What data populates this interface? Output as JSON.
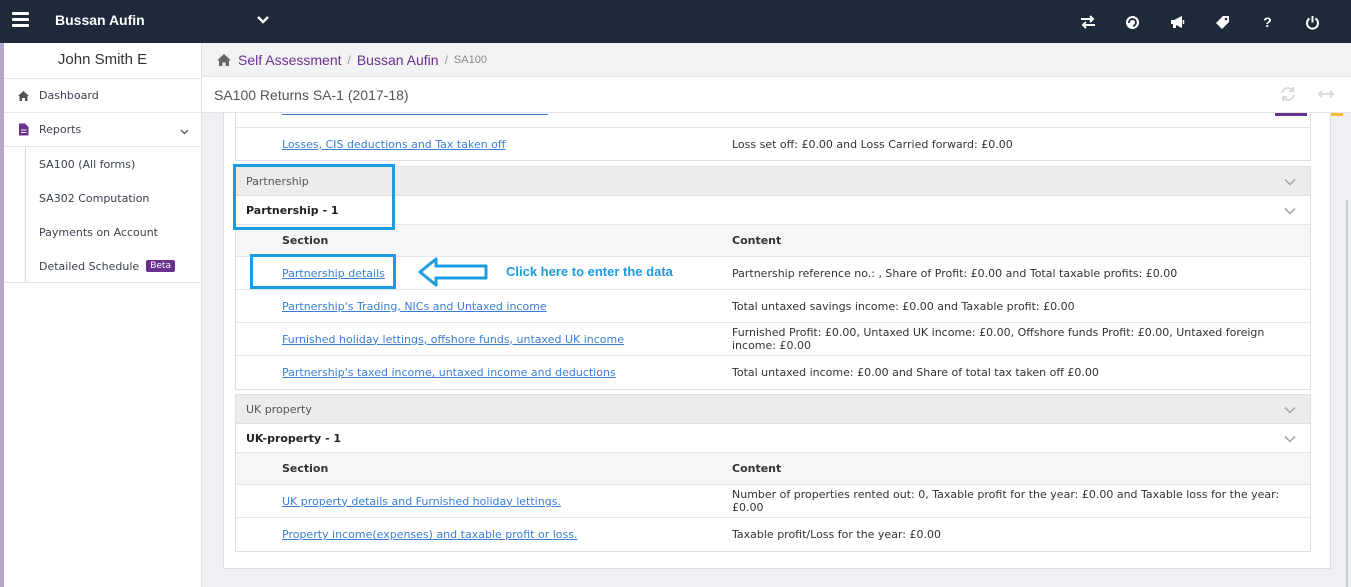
{
  "topbar": {
    "brand": "Bussan Aufin",
    "icons": [
      "switch-icon",
      "refresh-circle-icon",
      "megaphone-icon",
      "tag-icon",
      "help-icon",
      "power-icon"
    ],
    "help_label": "?"
  },
  "sidebar": {
    "user_name": "John Smith E",
    "items": [
      {
        "label": "Dashboard",
        "icon": "home-icon"
      },
      {
        "label": "Reports",
        "icon": "document-icon"
      }
    ],
    "subitems": [
      {
        "label": "SA100 (All forms)"
      },
      {
        "label": "SA302 Computation"
      },
      {
        "label": "Payments on Account"
      },
      {
        "label": "Detailed Schedule",
        "badge": "Beta"
      }
    ]
  },
  "breadcrumb": {
    "items": [
      "Self Assessment",
      "Bussan Aufin"
    ],
    "current": "SA100",
    "sep": "/"
  },
  "page": {
    "title": "SA100 Returns SA-1 (2017-18)"
  },
  "top_fragment": {
    "link": "Losses, CIS deductions and Tax taken off",
    "content": "Loss set off: £0.00 and Loss Carried forward: £0.00"
  },
  "partnership": {
    "group_title": "Partnership",
    "sub_title": "Partnership - 1",
    "col_section": "Section",
    "col_content": "Content",
    "rows": [
      {
        "link": "Partnership details",
        "content": "Partnership reference no.: , Share of Profit: £0.00 and Total taxable profits: £0.00"
      },
      {
        "link": "Partnership's Trading, NICs and Untaxed income",
        "content": "Total untaxed savings income: £0.00 and Taxable profit: £0.00"
      },
      {
        "link": "Furnished holiday lettings, offshore funds, untaxed UK income",
        "content": "Furnished Profit: £0.00, Untaxed UK income: £0.00, Offshore funds Profit: £0.00, Untaxed foreign income: £0.00"
      },
      {
        "link": "Partnership's taxed income, untaxed income and deductions",
        "content": "Total untaxed income: £0.00 and Share of total tax taken off £0.00"
      }
    ]
  },
  "uk_property": {
    "group_title": "UK property",
    "sub_title": "UK-property - 1",
    "col_section": "Section",
    "col_content": "Content",
    "rows": [
      {
        "link": "UK property details and Furnished holiday lettings.",
        "content": "Number of properties rented out: 0, Taxable profit for the year: £0.00 and Taxable loss for the year: £0.00"
      },
      {
        "link": "Property income(expenses) and taxable profit or loss.",
        "content": "Taxable profit/Loss for the year: £0.00"
      }
    ]
  },
  "annotation": {
    "text": "Click here to enter the data",
    "color": "#1c9be0"
  },
  "colors": {
    "topbar": "#1e2a3a",
    "accent_purple": "#6b2f8f",
    "link_blue": "#3a7fd4"
  }
}
